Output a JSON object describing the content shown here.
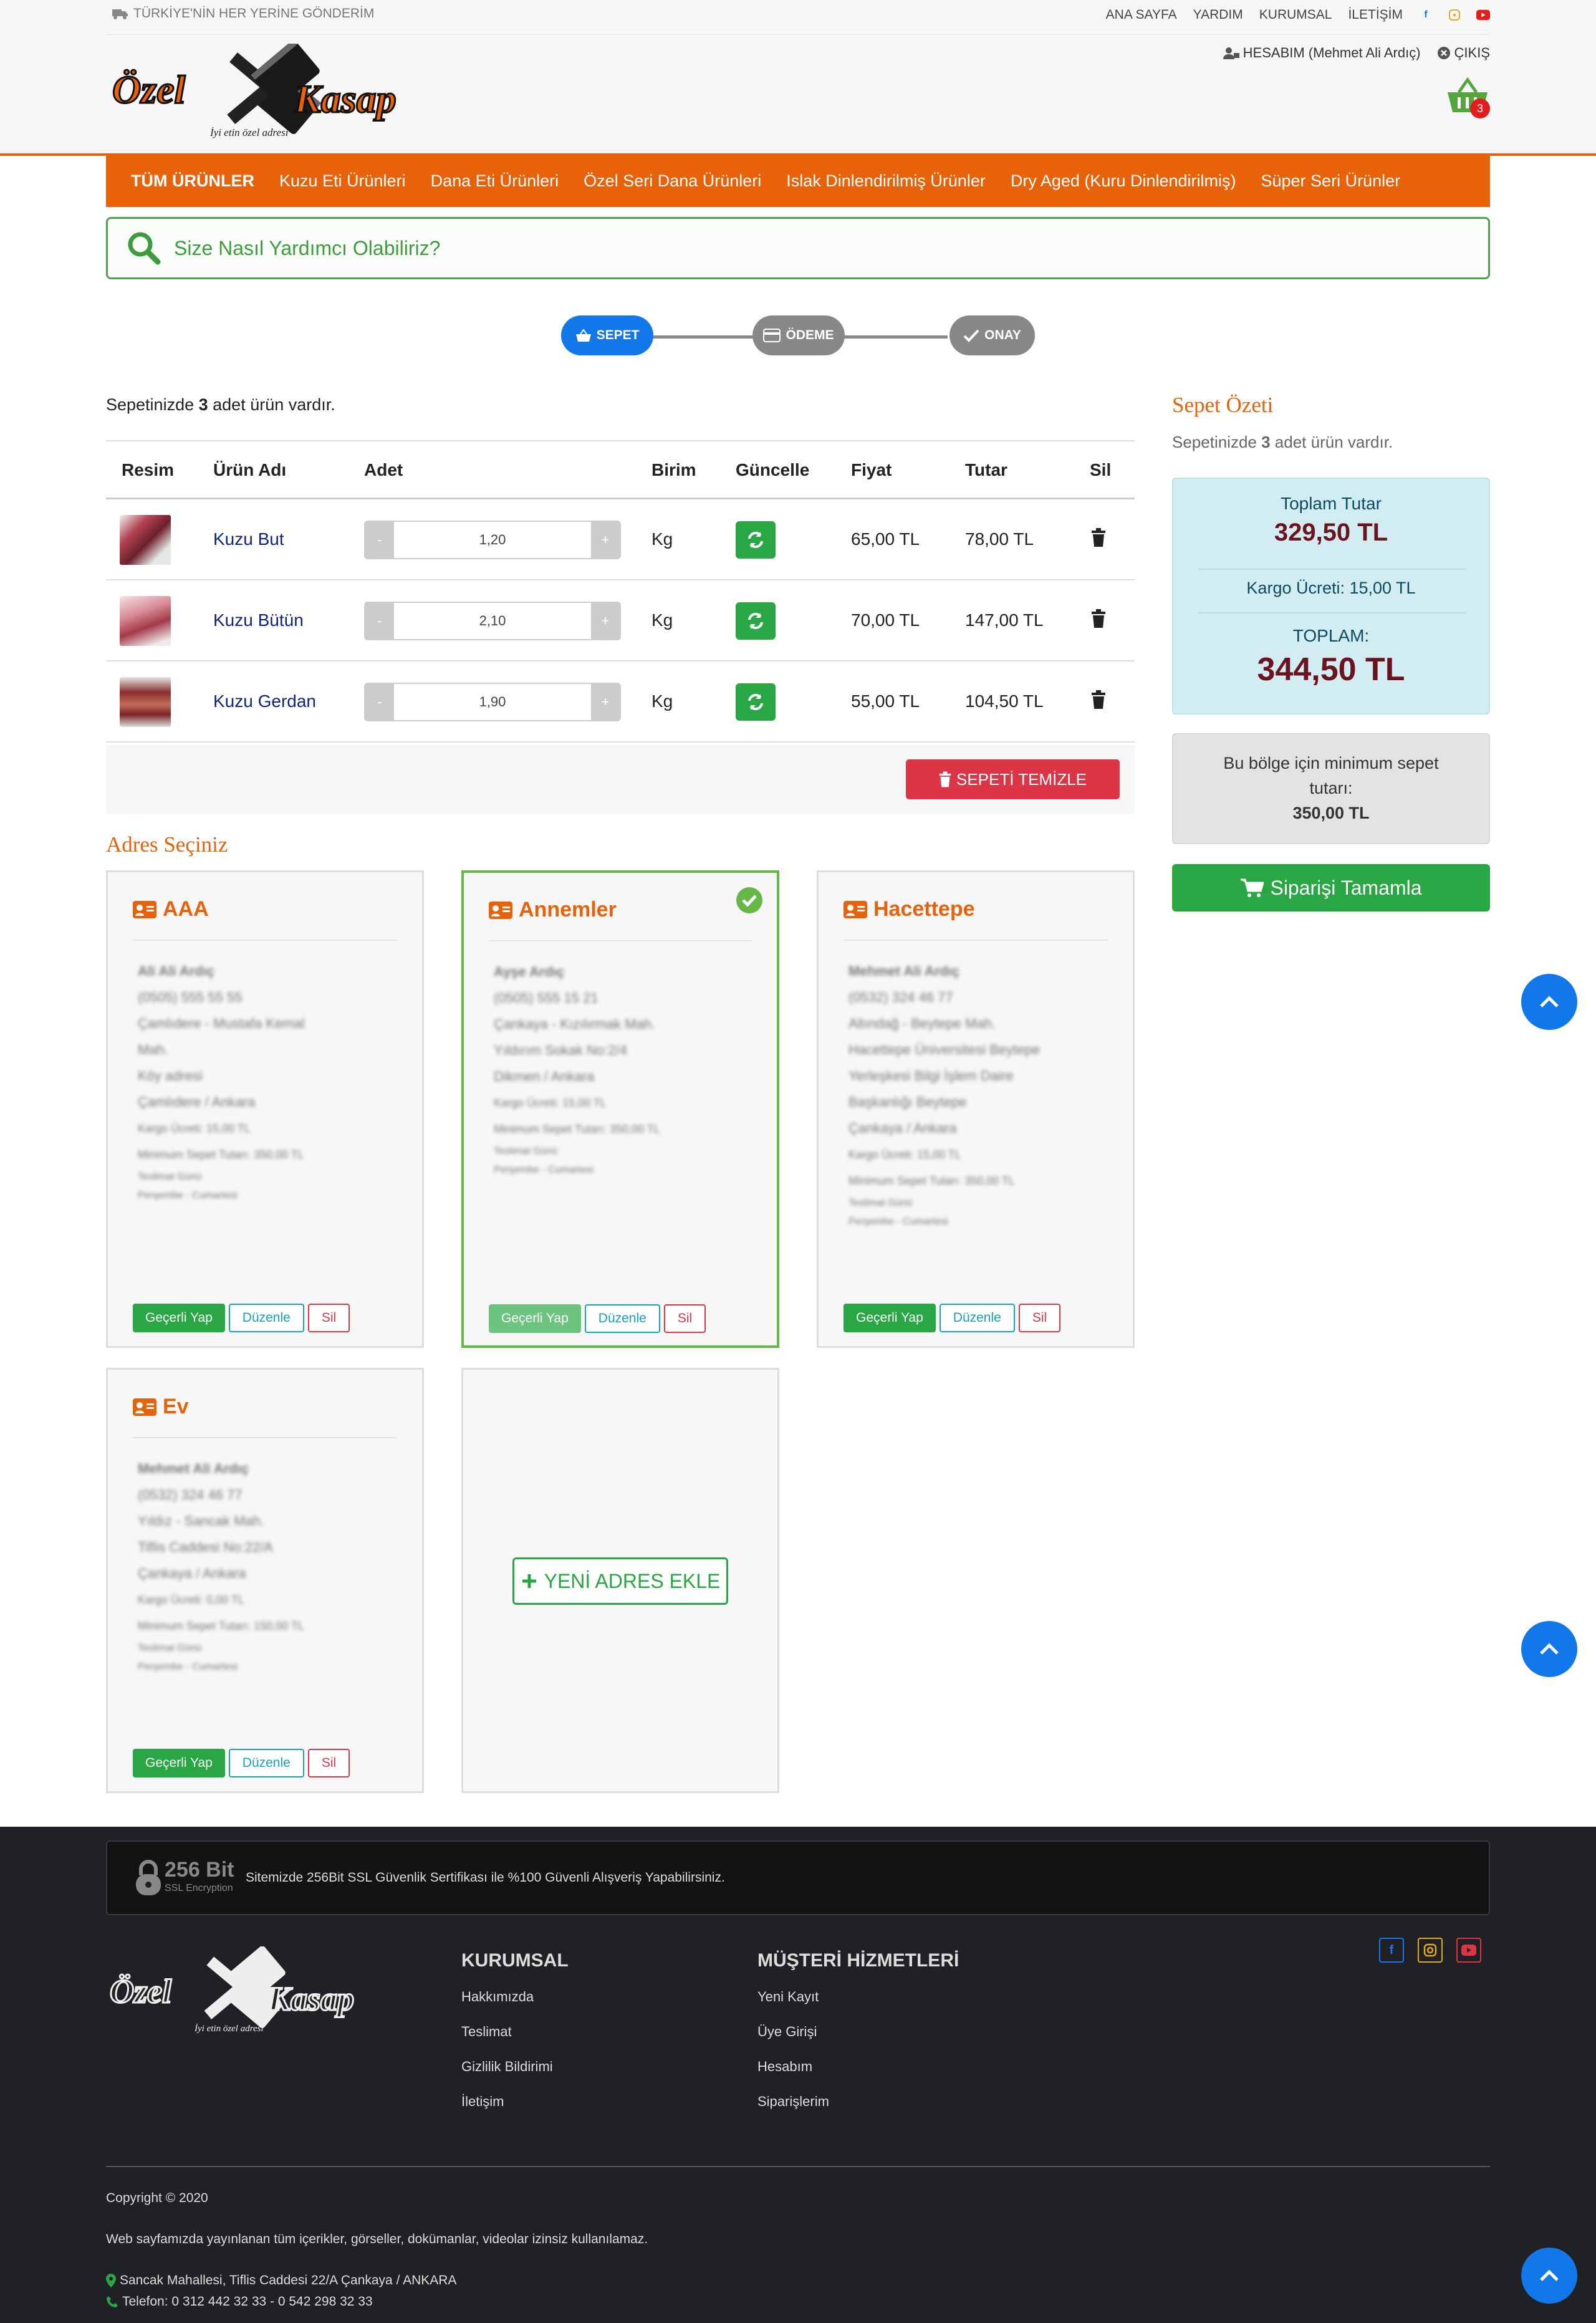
{
  "header": {
    "shipping_note": "TÜRKİYE'NİN HER YERİNE GÖNDERİM",
    "links": [
      "ANA SAYFA",
      "YARDIM",
      "KURUMSAL",
      "İLETİŞİM"
    ],
    "account": "HESABIM (Mehmet Ali Ardıç)",
    "logout": "ÇIKIŞ",
    "logo_text_left": "Özel",
    "logo_text_right": "Kasap",
    "logo_tagline": "İyi etin özel adresi",
    "cart_count": "3"
  },
  "nav": {
    "items": [
      "TÜM ÜRÜNLER",
      "Kuzu Eti Ürünleri",
      "Dana Eti Ürünleri",
      "Özel Seri Dana Ürünleri",
      "Islak Dinlendirilmiş Ürünler",
      "Dry Aged (Kuru Dinlendirilmiş)",
      "Süper Seri Ürünler"
    ]
  },
  "search": {
    "placeholder": "Size Nasıl Yardımcı Olabiliriz?"
  },
  "steps": {
    "cart": "SEPET",
    "payment": "ÖDEME",
    "confirm": "ONAY"
  },
  "cart": {
    "info_prefix": "Sepetinizde ",
    "info_count": "3",
    "info_suffix": " adet ürün vardır.",
    "columns": [
      "Resim",
      "Ürün Adı",
      "Adet",
      "Birim",
      "Güncelle",
      "Fiyat",
      "Tutar",
      "Sil"
    ],
    "rows": [
      {
        "name": "Kuzu But",
        "qty": "1,20",
        "unit": "Kg",
        "price": "65,00 TL",
        "total": "78,00 TL"
      },
      {
        "name": "Kuzu Bütün",
        "qty": "2,10",
        "unit": "Kg",
        "price": "70,00 TL",
        "total": "147,00 TL"
      },
      {
        "name": "Kuzu Gerdan",
        "qty": "1,90",
        "unit": "Kg",
        "price": "55,00 TL",
        "total": "104,50 TL"
      }
    ],
    "minus": "-",
    "plus": "+",
    "clear_label": "SEPETİ TEMİZLE"
  },
  "addresses": {
    "title": "Adres Seçiniz",
    "set_default": "Geçerli Yap",
    "edit": "Düzenle",
    "delete": "Sil",
    "new_label": "YENİ ADRES EKLE",
    "cards": [
      {
        "title": "AAA",
        "lines": [
          "Ali Ali Ardıç",
          "(0505) 555 55 55",
          "Çamlıdere - Mustafa Kemal",
          "Mah.",
          "Köy adresi",
          "Çamlıdere / Ankara",
          "Kargo Ücreti: 15,00 TL",
          "Minimum Sepet Tutarı: 350,00 TL",
          "Teslimat Günü",
          "Perşembe - Cumartesi"
        ]
      },
      {
        "title": "Annemler",
        "lines": [
          "Ayşe Ardıç",
          "(0505) 555 15 21",
          "Çankaya - Kızılırmak Mah.",
          "Yıldırım Sokak No:2/4",
          "Dikmen / Ankara",
          "Kargo Ücreti: 15,00 TL",
          "Minimum Sepet Tutarı: 350,00 TL",
          "Teslimat Günü",
          "Perşembe - Cumartesi"
        ]
      },
      {
        "title": "Hacettepe",
        "lines": [
          "Mehmet Ali Ardıç",
          "(0532) 324 46 77",
          "Altındağ - Beytepe Mah.",
          "Hacettepe Üniversitesi Beytepe",
          "Yerleşkesi Bilgi İşlem Daire",
          "Başkanlığı Beytepe",
          "Çankaya / Ankara",
          "Kargo Ücreti: 15,00 TL",
          "Minimum Sepet Tutarı: 350,00 TL",
          "Teslimat Günü",
          "Perşembe - Cumartesi"
        ]
      },
      {
        "title": "Ev",
        "lines": [
          "Mehmet Ali Ardıç",
          "(0532) 324 46 77",
          "Yıldız - Sancak Mah.",
          "Tiflis Caddesi No:22/A",
          "Çankaya / Ankara",
          "Kargo Ücreti: 0,00 TL",
          "Minimum Sepet Tutarı: 150,00 TL",
          "Teslimat Günü",
          "Perşembe - Cumartesi"
        ]
      }
    ]
  },
  "summary": {
    "title": "Sepet Özeti",
    "sub_prefix": "Sepetinizde ",
    "sub_count": "3",
    "sub_suffix": " adet ürün vardır.",
    "total_label": "Toplam Tutar",
    "total_value": "329,50 TL",
    "shipping_label": "Kargo Ücreti: 15,00 TL",
    "grand_label": "TOPLAM:",
    "grand_value": "344,50 TL",
    "min_line1": "Bu bölge için minimum sepet",
    "min_line2": "tutarı:",
    "min_value": "350,00 TL",
    "order_label": "Siparişi Tamamla"
  },
  "footer": {
    "ssl_badge": "256 Bit",
    "ssl_badge_sub": "SSL Encryption",
    "ssl_text": "Sitemizde 256Bit SSL Güvenlik Sertifikası ile %100 Güvenli Alışveriş Yapabilirsiniz.",
    "corporate_title": "KURUMSAL",
    "corporate_links": [
      "Hakkımızda",
      "Teslimat",
      "Gizlilik Bildirimi",
      "İletişim"
    ],
    "service_title": "MÜŞTERİ HİZMETLERİ",
    "service_links": [
      "Yeni Kayıt",
      "Üye Girişi",
      "Hesabım",
      "Siparişlerim"
    ],
    "copyright": "Copyright © 2020",
    "notice": "Web sayfamızda yayınlanan tüm içerikler, görseller, dokümanlar, videolar izinsiz kullanılamaz.",
    "address": "Sancak Mahallesi, Tiflis Caddesi 22/A Çankaya / ANKARA",
    "phone": "Telefon: 0 312 442 32 33 - 0 542 298 32 33"
  },
  "colors": {
    "brand_orange": "#e8620a",
    "green": "#2aa745",
    "red": "#dc3545",
    "blue": "#1277e8"
  }
}
